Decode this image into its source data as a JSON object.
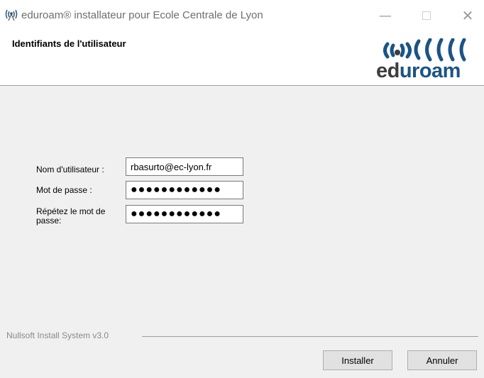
{
  "window": {
    "title": "eduroam® installateur pour Ecole Centrale de Lyon",
    "app_icon": "wifi-antenna-icon",
    "controls": [
      "minimize",
      "maximize",
      "close"
    ]
  },
  "header": {
    "title": "Identifiants de l'utilisateur",
    "logo": {
      "prefix": "ed",
      "suffix": "uroam",
      "colors": {
        "dark": "#3d3d3d",
        "accent": "#1b5485"
      }
    }
  },
  "form": {
    "username": {
      "label": "Nom d'utilisateur :",
      "value": "rbasurto@ec-lyon.fr"
    },
    "password": {
      "label": "Mot de passe :",
      "masked": "●●●●●●●●●●●●"
    },
    "password_repeat": {
      "label": "Répétez le mot de passe:",
      "masked": "●●●●●●●●●●●●"
    }
  },
  "footer": {
    "branding": "Nullsoft Install System v3.0",
    "buttons": {
      "install": "Installer",
      "cancel": "Annuler"
    }
  }
}
